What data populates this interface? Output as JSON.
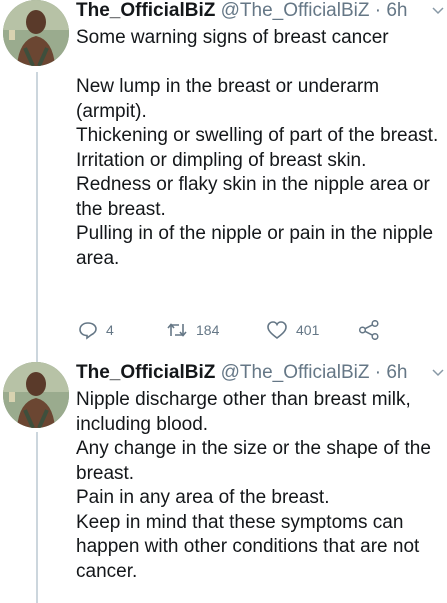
{
  "tweets": [
    {
      "name": "The_OfficialBiZ",
      "handle": "@The_OfficialBiZ",
      "separator": "·",
      "time": "6h",
      "intro": "Some warning signs of breast cancer",
      "paragraphs": [
        "New lump in the breast or underarm (armpit).",
        "Thickening or swelling of part of the breast.",
        "Irritation or dimpling of breast skin.",
        "Redness or flaky skin in the nipple area or the breast.",
        "Pulling in of the nipple or pain in the nipple area."
      ],
      "actions": {
        "replies": "4",
        "retweets": "184",
        "likes": "401"
      }
    },
    {
      "name": "The_OfficialBiZ",
      "handle": "@The_OfficialBiZ",
      "separator": "·",
      "time": "6h",
      "paragraphs": [
        "Nipple discharge other than breast milk, including blood.",
        "Any change in the size or the shape of the breast.",
        "Pain in any area of the breast.",
        "Keep in mind that these symptoms can happen with other conditions that are not cancer."
      ]
    }
  ],
  "icons": {
    "reply": "reply-icon",
    "retweet": "retweet-icon",
    "like": "heart-icon",
    "share": "share-icon",
    "more": "chevron-down-icon"
  },
  "colors": {
    "text": "#14171a",
    "secondary": "#657786",
    "thread_line": "#ccd6dd"
  }
}
